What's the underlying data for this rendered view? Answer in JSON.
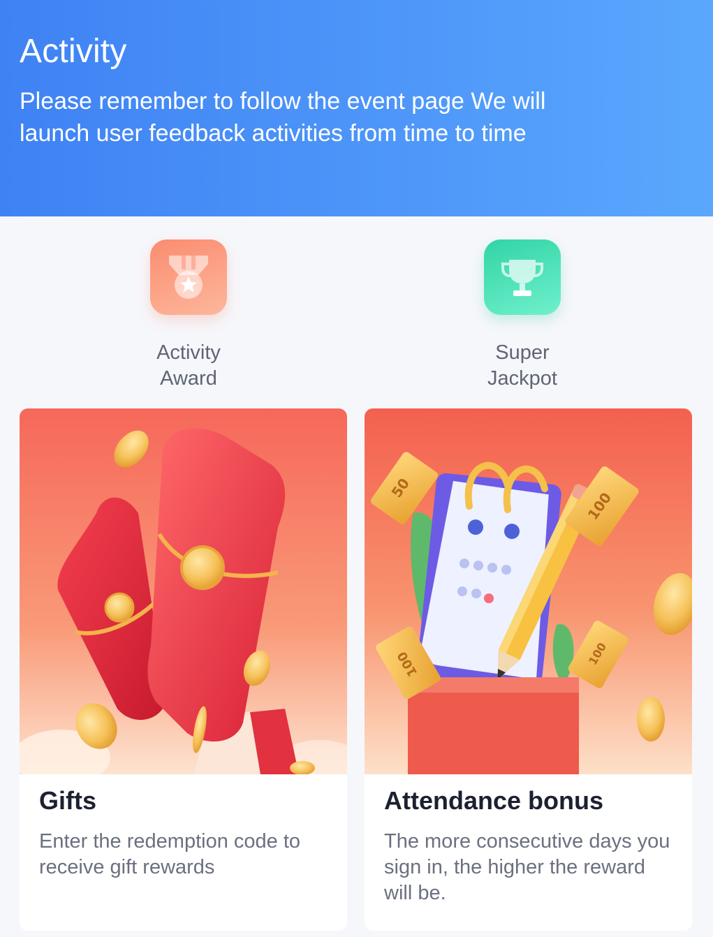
{
  "header": {
    "title": "Activity",
    "subtitle": "Please remember to follow the event page We will launch user feedback activities from time to time"
  },
  "entries": [
    {
      "label": "Activity Award",
      "icon": "medal-icon",
      "color": "#fb8c70"
    },
    {
      "label": "Super Jackpot",
      "icon": "trophy-icon",
      "color": "#32d4a6"
    }
  ],
  "cards": [
    {
      "title": "Gifts",
      "description": "Enter the redemption code to receive gift rewards",
      "illustration": "red-envelope-illustration",
      "color": "#f0383f"
    },
    {
      "title": "Attendance bonus",
      "description": "The more consecutive days you sign in, the higher the reward will be.",
      "illustration": "calendar-pencil-illustration",
      "tickets": [
        "50",
        "100",
        "100",
        "100"
      ],
      "color": "#f3654e"
    }
  ],
  "colors": {
    "header_start": "#3f82f4",
    "header_end": "#5aa7fd",
    "background": "#f6f7fb"
  }
}
